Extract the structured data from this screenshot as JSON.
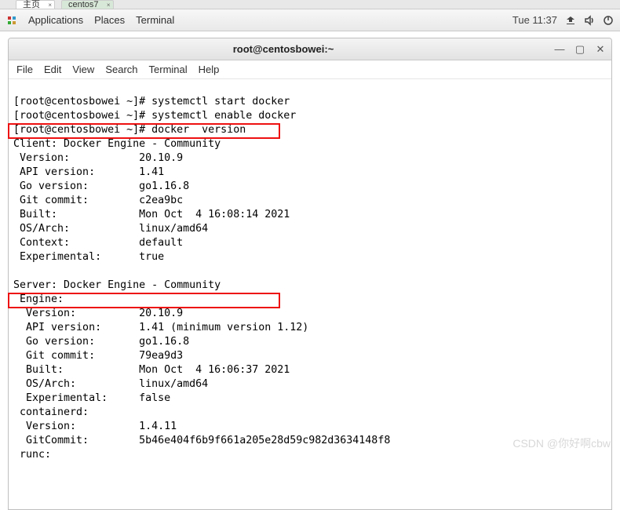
{
  "browser_tabs": {
    "tab1": "主页",
    "tab2": "centos7"
  },
  "panel": {
    "applications": "Applications",
    "places": "Places",
    "terminal": "Terminal",
    "clock": "Tue 11:37"
  },
  "window": {
    "title": "root@centosbowei:~",
    "menu": {
      "file": "File",
      "edit": "Edit",
      "view": "View",
      "search": "Search",
      "terminal": "Terminal",
      "help": "Help"
    }
  },
  "term": {
    "l01": "[root@centosbowei ~]# systemctl start docker",
    "l02": "[root@centosbowei ~]# systemctl enable docker",
    "l03": "[root@centosbowei ~]# docker  version",
    "l04": "Client: Docker Engine - Community",
    "l05": " Version:           20.10.9",
    "l06": " API version:       1.41",
    "l07": " Go version:        go1.16.8",
    "l08": " Git commit:        c2ea9bc",
    "l09": " Built:             Mon Oct  4 16:08:14 2021",
    "l10": " OS/Arch:           linux/amd64",
    "l11": " Context:           default",
    "l12": " Experimental:      true",
    "l13": "",
    "l14": "Server: Docker Engine - Community",
    "l15": " Engine:",
    "l16": "  Version:          20.10.9",
    "l17": "  API version:      1.41 (minimum version 1.12)",
    "l18": "  Go version:       go1.16.8",
    "l19": "  Git commit:       79ea9d3",
    "l20": "  Built:            Mon Oct  4 16:06:37 2021",
    "l21": "  OS/Arch:          linux/amd64",
    "l22": "  Experimental:     false",
    "l23": " containerd:",
    "l24": "  Version:          1.4.11",
    "l25": "  GitCommit:        5b46e404f6b9f661a205e28d59c982d3634148f8",
    "l26": " runc:"
  },
  "watermark": "CSDN @你好啊cbw"
}
